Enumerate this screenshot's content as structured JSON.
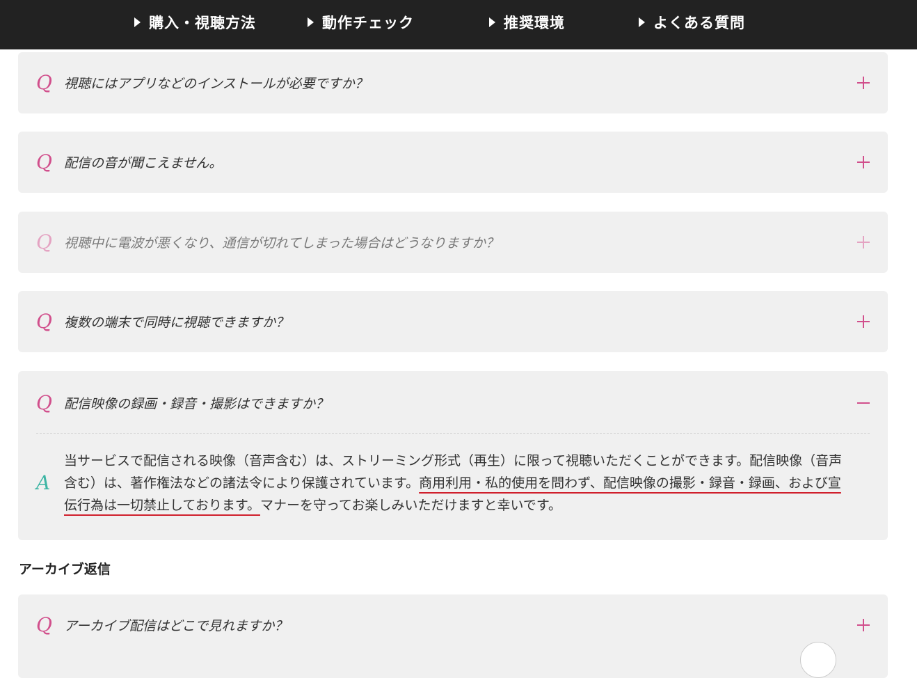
{
  "nav": {
    "items": [
      "購入・視聴方法",
      "動作チェック",
      "推奨環境",
      "よくある質問"
    ]
  },
  "faqs": [
    {
      "q": "Q",
      "text": "視聴にはアプリなどのインストールが必要ですか？"
    },
    {
      "q": "Q",
      "text": "配信の音が聞こえません。"
    },
    {
      "q": "Q",
      "text": "視聴中に電波が悪くなり、通信が切れてしまった場合はどうなりますか？"
    },
    {
      "q": "Q",
      "text": "複数の端末で同時に視聴できますか？"
    },
    {
      "q": "Q",
      "text": "配信映像の録画・録音・撮影はできますか？",
      "answer": {
        "a": "A",
        "part1": "当サービスで配信される映像（音声含む）は、ストリーミング形式（再生）に限って視聴いただくことができます。配信映像（音声含む）は、著作権法などの諸法令により保護されています。",
        "part2": "商用利用・私的使用を問わず、配信映像の撮影・録音・録画、および宣伝行為は一切禁止しております。",
        "part3": "マナーを守ってお楽しみいただけますと幸いです。"
      }
    }
  ],
  "archive": {
    "title": "アーカイブ返信",
    "faq": {
      "q": "Q",
      "text": "アーカイブ配信はどこで見れますか？"
    }
  },
  "colors": {
    "nav_bg": "#222222",
    "accent_pink": "#d14f8c",
    "accent_teal": "#3db5a4",
    "underline_red": "#d01f2c"
  }
}
